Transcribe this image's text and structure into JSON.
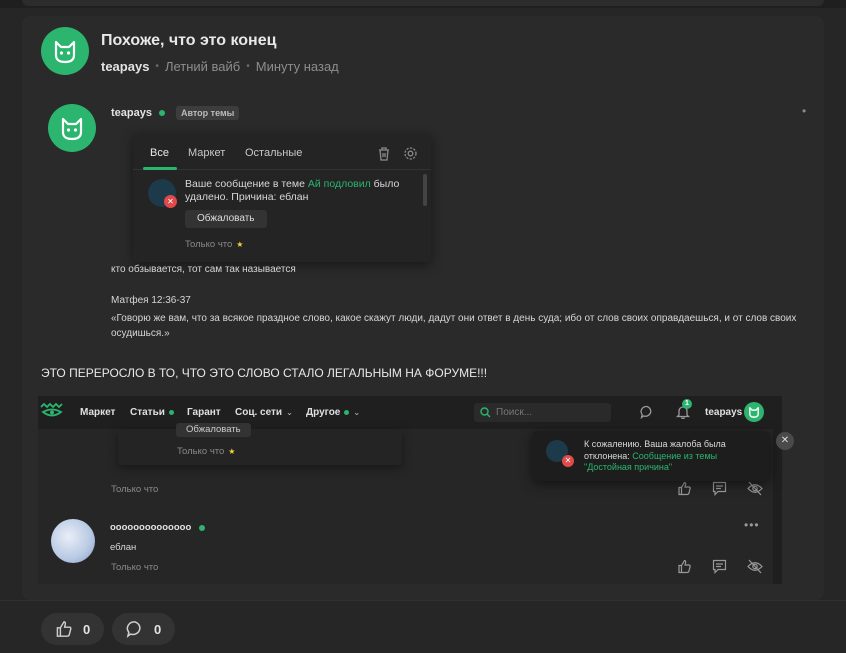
{
  "thread": {
    "title": "Похоже, что это конец",
    "author": "teapays",
    "forum": "Летний вайб",
    "time": "Минуту назад"
  },
  "post": {
    "author": "teapays",
    "badge": "Автор темы",
    "lines": [
      "кто обзывается, тот сам так называется",
      "Матфея 12:36-37",
      "«Говорю же вам, что за всякое праздное слово, какое скажут люди, дадут они ответ в день суда; ибо от слов своих оправдаешься, и от слов своих осудишься.»"
    ],
    "caption": "ЭТО ПЕРЕРОСЛО В ТО, ЧТО ЭТО СЛОВО СТАЛО ЛЕГАЛЬНЫМ НА ФОРУМЕ!!!"
  },
  "notif_popup": {
    "tabs": [
      "Все",
      "Маркет",
      "Остальные"
    ],
    "message_pre": "Ваше сообщение в теме ",
    "message_link": "Ай подловил",
    "message_post": " было удалено. Причина: еблан",
    "appeal_button": "Обжаловать",
    "time": "Только что"
  },
  "navbar": {
    "items": [
      "Маркет",
      "Статьи",
      "Гарант",
      "Соц. сети",
      "Другое"
    ],
    "search_placeholder": "Поиск...",
    "bell_count": "1",
    "user": "teapays"
  },
  "embedded": {
    "appeal_button": "Обжаловать",
    "time_star": "Только что",
    "time1": "Только что",
    "reply_user": "оооооооооооооо",
    "reply_msg": "еблан",
    "time2": "Только что"
  },
  "toast": {
    "text_pre": "К сожалению. Ваша жалоба была отклонена: ",
    "link": "Сообщение из темы \"Достойная причина\"",
    "close": "✕"
  },
  "footer": {
    "likes": "0",
    "comments": "0"
  },
  "colors": {
    "accent": "#2bb56e",
    "danger": "#e04a4a",
    "star": "#f2d23c"
  }
}
